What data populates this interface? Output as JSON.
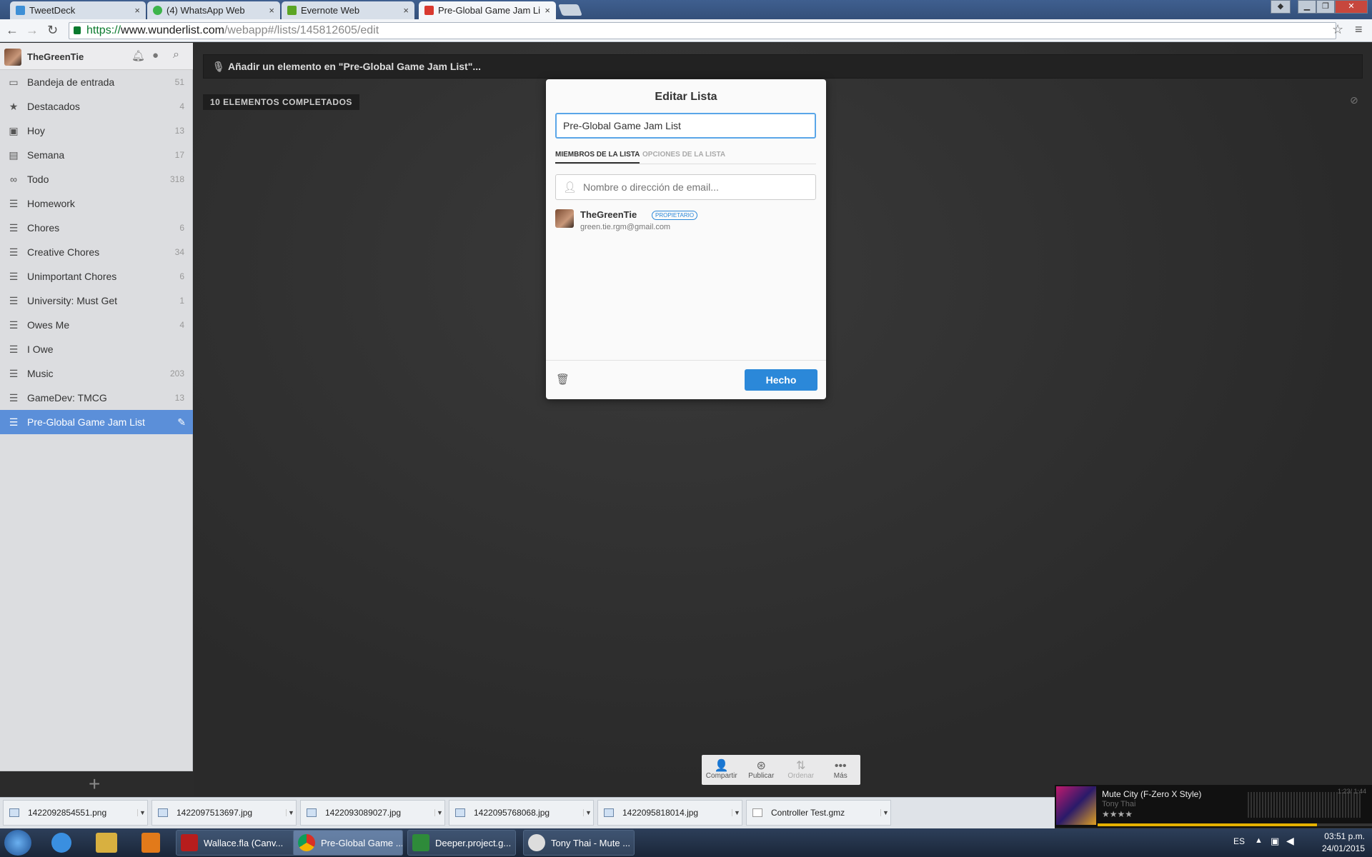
{
  "browser": {
    "tabs": [
      {
        "label": "TweetDeck",
        "color": "#3d8fd6"
      },
      {
        "label": "(4) WhatsApp Web",
        "color": "#3cb44a"
      },
      {
        "label": "Evernote Web",
        "color": "#5ba524"
      },
      {
        "label": "Pre-Global Game Jam List",
        "color": "#d9392f"
      }
    ],
    "close_glyph": "×",
    "url_scheme": "https://",
    "url_host": "www.wunderlist.com",
    "url_path": "/webapp#/lists/145812605/edit"
  },
  "sidebar": {
    "user": "TheGreenTie",
    "items": [
      {
        "label": "Bandeja de entrada",
        "count": "51",
        "icon": "inbox-icon",
        "glyph": "▭"
      },
      {
        "label": "Destacados",
        "count": "4",
        "icon": "star-icon",
        "glyph": "★"
      },
      {
        "label": "Hoy",
        "count": "13",
        "icon": "calendar-today-icon",
        "glyph": "▣"
      },
      {
        "label": "Semana",
        "count": "17",
        "icon": "calendar-week-icon",
        "glyph": "▤"
      },
      {
        "label": "Todo",
        "count": "318",
        "icon": "infinity-icon",
        "glyph": "∞"
      },
      {
        "label": "Homework",
        "count": "",
        "icon": "list-icon",
        "glyph": "☰"
      },
      {
        "label": "Chores",
        "count": "6",
        "icon": "list-icon",
        "glyph": "☰"
      },
      {
        "label": "Creative Chores",
        "count": "34",
        "icon": "list-icon",
        "glyph": "☰"
      },
      {
        "label": "Unimportant Chores",
        "count": "6",
        "icon": "list-icon",
        "glyph": "☰"
      },
      {
        "label": "University: Must Get",
        "count": "1",
        "icon": "list-icon",
        "glyph": "☰"
      },
      {
        "label": "Owes Me",
        "count": "4",
        "icon": "list-icon",
        "glyph": "☰"
      },
      {
        "label": "I Owe",
        "count": "",
        "icon": "list-icon",
        "glyph": "☰"
      },
      {
        "label": "Music",
        "count": "203",
        "icon": "list-icon",
        "glyph": "☰"
      },
      {
        "label": "GameDev: TMCG",
        "count": "13",
        "icon": "list-icon",
        "glyph": "☰"
      },
      {
        "label": "Pre-Global Game Jam List",
        "count": "",
        "icon": "list-icon",
        "glyph": "☰",
        "selected": true
      }
    ],
    "add_glyph": "+"
  },
  "main": {
    "add_item_placeholder": "Añadir un elemento en \"Pre-Global Game Jam List\"...",
    "completed_label": "10 ELEMENTOS COMPLETADOS"
  },
  "modal": {
    "title": "Editar Lista",
    "list_name": "Pre-Global Game Jam List",
    "tab_members": "MIEMBROS DE LA LISTA",
    "tab_options": "OPCIONES DE LA LISTA",
    "member_placeholder": "Nombre o dirección de email...",
    "member": {
      "name": "TheGreenTie",
      "role": "PROPIETARIO",
      "email": "green.tie.rgm@gmail.com"
    },
    "done_label": "Hecho"
  },
  "bottom_toolbar": [
    {
      "label": "Compartir",
      "glyph": "👤"
    },
    {
      "label": "Publicar",
      "glyph": "⊛"
    },
    {
      "label": "Ordenar",
      "glyph": "⇅"
    },
    {
      "label": "Más",
      "glyph": "•••"
    }
  ],
  "downloads": [
    "1422092854551.png",
    "1422097513697.jpg",
    "1422093089027.jpg",
    "1422095768068.jpg",
    "1422095818014.jpg",
    "Controller Test.gmz"
  ],
  "player": {
    "title": "Mute City (F-Zero X Style)",
    "artist": "Tony Thai",
    "time": "1:23/ 1:44",
    "rating": "★★★★"
  },
  "taskbar": {
    "items": [
      "Wallace.fla (Canv...",
      "Pre-Global Game ...",
      "Deeper.project.g...",
      "Tony Thai - Mute ..."
    ],
    "lang": "ES",
    "time": "03:51 p.m.",
    "date": "24/01/2015"
  }
}
